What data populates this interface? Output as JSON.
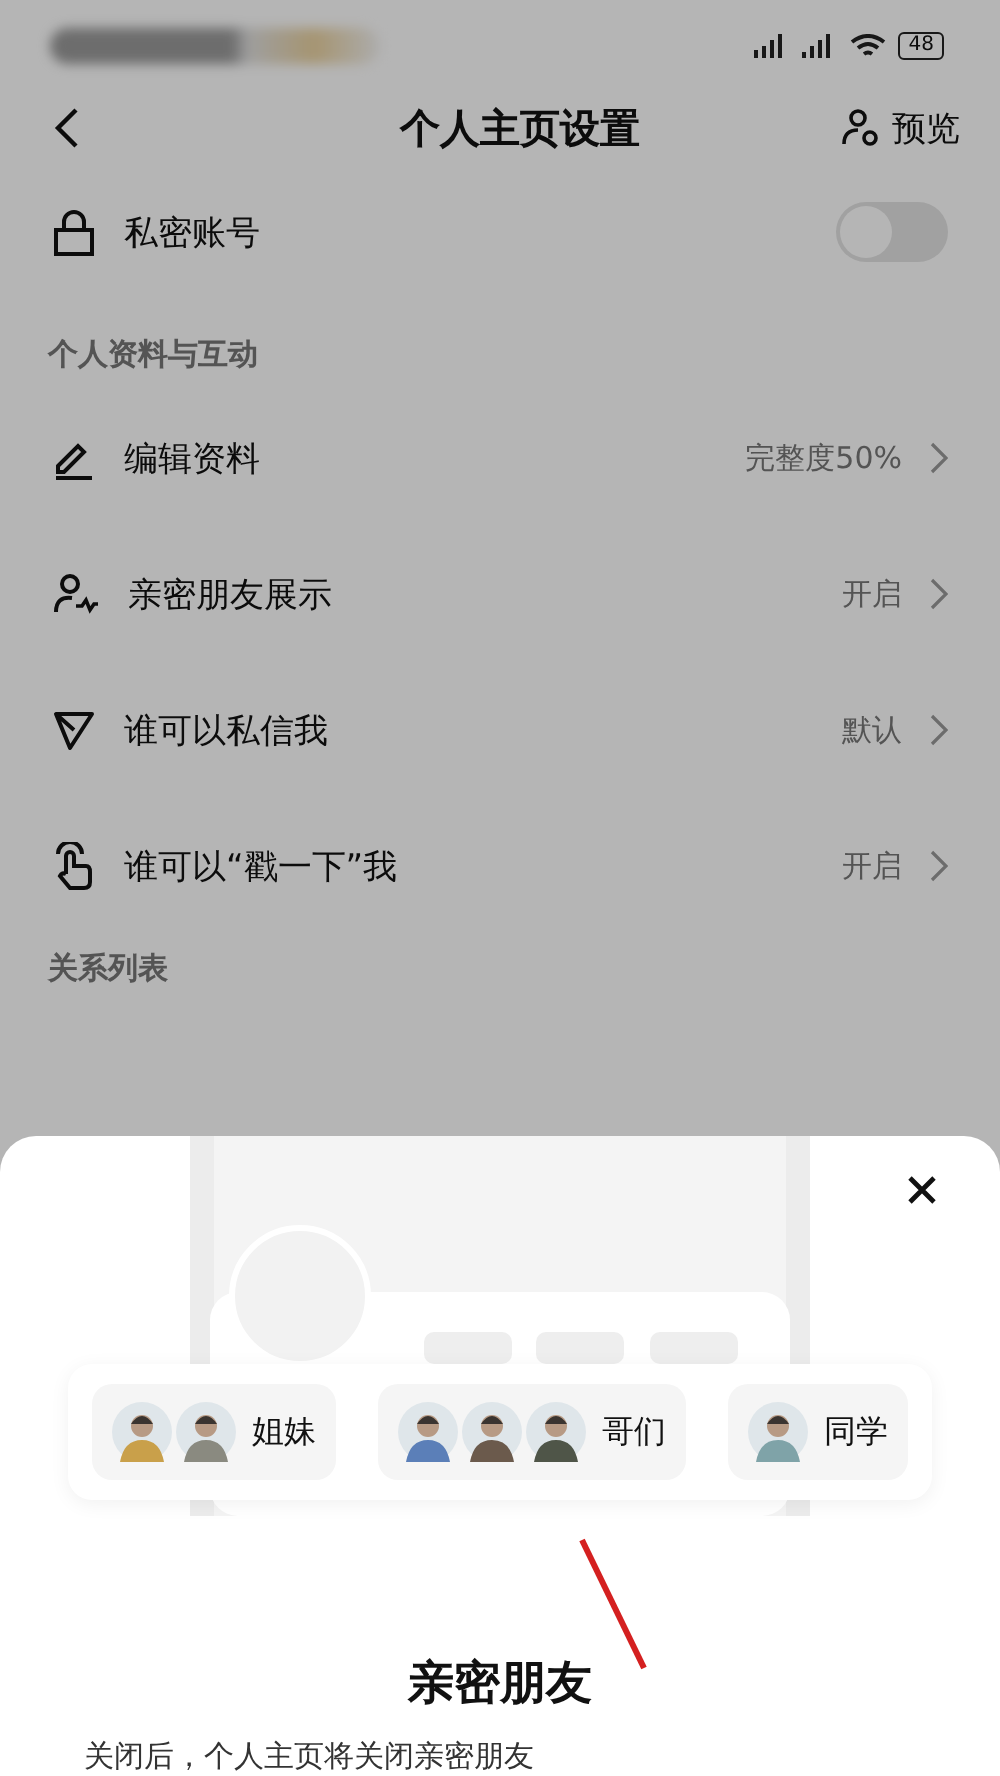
{
  "status_bar": {
    "battery": "48"
  },
  "header": {
    "title": "个人主页设置",
    "action": "预览"
  },
  "privacy": {
    "label": "私密账号",
    "on": false
  },
  "section": {
    "title": "个人资料与互动",
    "rows": [
      {
        "kind": "edit",
        "label": "编辑资料",
        "value": "完整度50%"
      },
      {
        "kind": "friends",
        "label": "亲密朋友展示",
        "value": "开启"
      },
      {
        "kind": "send",
        "label": "谁可以私信我",
        "value": "默认"
      },
      {
        "kind": "poke",
        "label": "谁可以“戳一下”我",
        "value": "开启"
      }
    ]
  },
  "next_section": {
    "title": "关系列表"
  },
  "sheet": {
    "title": "亲密朋友",
    "groups": [
      {
        "label": "姐妹"
      },
      {
        "label": "哥们"
      },
      {
        "label": "同学"
      }
    ],
    "description": "关闭后，个人主页将关闭亲密朋友"
  }
}
